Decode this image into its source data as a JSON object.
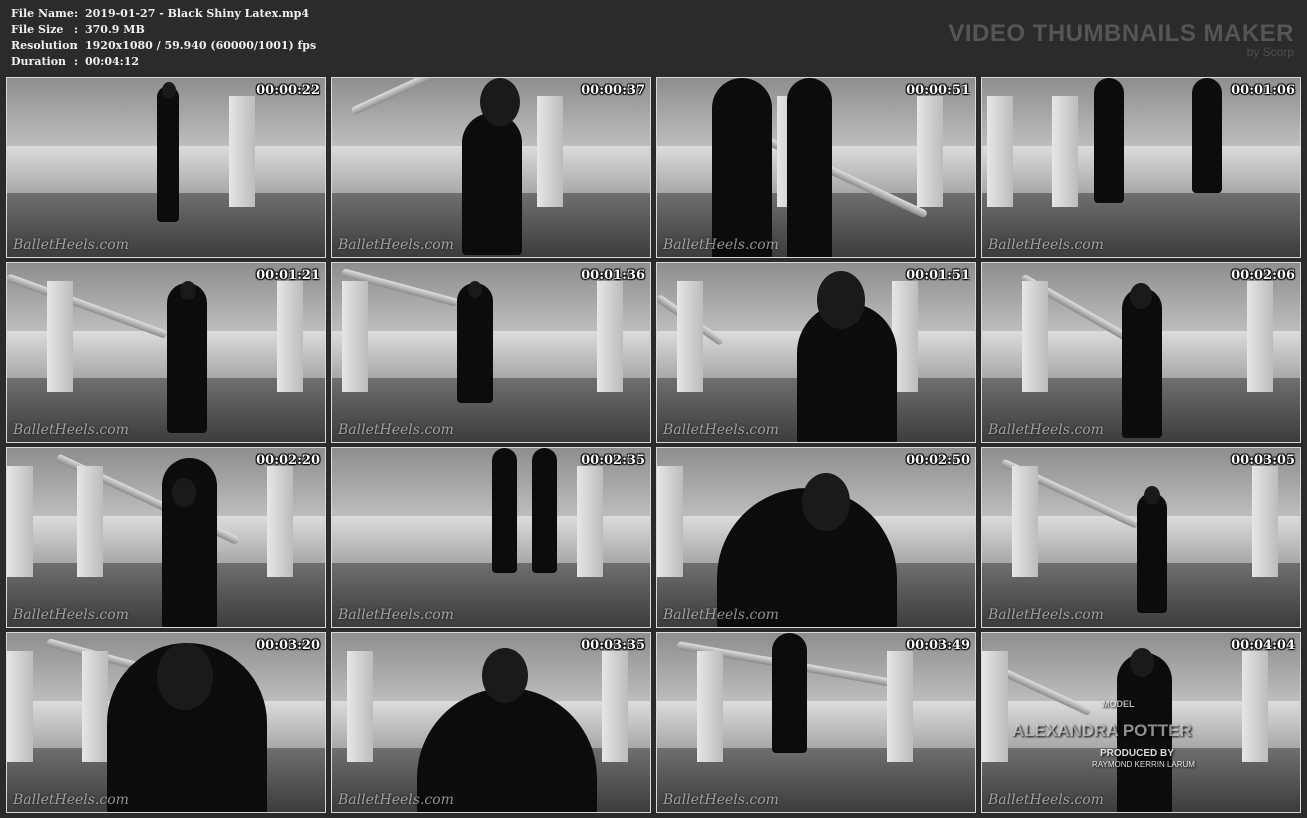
{
  "file_info": {
    "rows": [
      {
        "key": "File Name",
        "sep": ":",
        "value": "2019-01-27 - Black Shiny Latex.mp4"
      },
      {
        "key": "File Size",
        "sep": ":",
        "value": "370.9 MB"
      },
      {
        "key": "Resolution",
        "sep": ":",
        "value": "1920x1080 / 59.940 (60000/1001) fps"
      },
      {
        "key": "Duration",
        "sep": ":",
        "value": "00:04:12"
      }
    ]
  },
  "brand": {
    "title": "VIDEO THUMBNAILS MAKER",
    "subtitle": "by Scorp"
  },
  "watermark_text": "BalletHeels.com",
  "thumbnails": [
    {
      "timestamp": "00:00:22"
    },
    {
      "timestamp": "00:00:37"
    },
    {
      "timestamp": "00:00:51"
    },
    {
      "timestamp": "00:01:06"
    },
    {
      "timestamp": "00:01:21"
    },
    {
      "timestamp": "00:01:36"
    },
    {
      "timestamp": "00:01:51"
    },
    {
      "timestamp": "00:02:06"
    },
    {
      "timestamp": "00:02:20"
    },
    {
      "timestamp": "00:02:35"
    },
    {
      "timestamp": "00:02:50"
    },
    {
      "timestamp": "00:03:05"
    },
    {
      "timestamp": "00:03:20"
    },
    {
      "timestamp": "00:03:35"
    },
    {
      "timestamp": "00:03:49"
    },
    {
      "timestamp": "00:04:04"
    }
  ],
  "credits_overlay": {
    "model_label": "MODEL",
    "model_name": "ALEXANDRA POTTER",
    "produced_label": "PRODUCED BY",
    "producer_name": "RAYMOND KERRIN LARUM"
  },
  "colors": {
    "background": "#2b2b2b",
    "thumbnail_border": "#d8d8d8",
    "brand_text": "#555555",
    "info_text": "#f0f0f0"
  }
}
